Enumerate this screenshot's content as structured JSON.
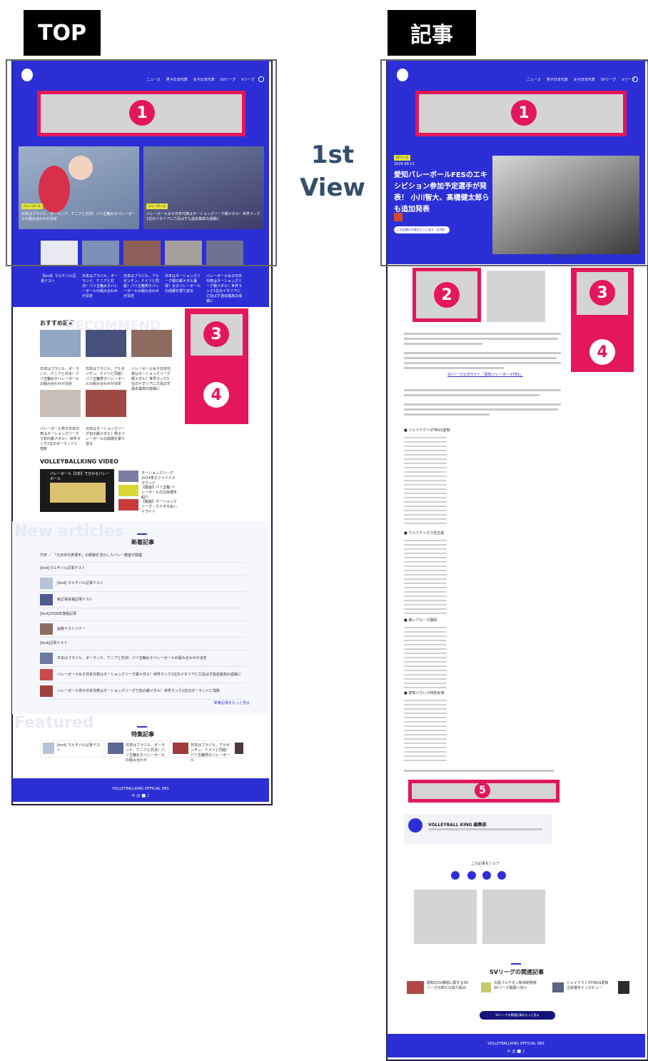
{
  "labels": {
    "top": "TOP",
    "article": "記事",
    "first_view": "1st View"
  },
  "badges": [
    "1",
    "2",
    "3",
    "4",
    "5"
  ],
  "site": {
    "nav": [
      "ニュース",
      "男子日本代表",
      "女子日本代表",
      "SVリーグ",
      "Vリーグ"
    ],
    "footer_title": "VOLLEYBALLKING OFFICIAL SNS"
  },
  "top": {
    "hero_cards": [
      {
        "tag": "バレーボール",
        "title": "日本はブラジル、ポーランド、ケニアと対決！パリ五輪女子バレーボールの組み合わせが決定"
      },
      {
        "tag": "バレーボール",
        "title": "バレーボール女子日本代表はネーションズリーグ銀メダル！世界ランク1位のイタリアに力及ばずも過去最高の成績に"
      }
    ],
    "thumbs": [
      {
        "title": "【bnd】マルチバル記事テスト"
      },
      {
        "title": "日本はブラジル、ポーランド、ケニアと対決！パリ五輪女子バレーボールの組み合わせが決定"
      },
      {
        "title": "日本はブラジル、アルゼンチン、ドイツと同組！パリ五輪男子バレーボールの組み合わせが決定"
      },
      {
        "title": "日本はネーションズリーグ銀の銀メダル獲得！女子バレーボールの成績を振り返る"
      },
      {
        "title": "バレーボール女子日本代表はネーションズリーグ銀メダル！世界ランク1位のイタリアに力及ばず過去最高の成績に"
      }
    ],
    "recommend_title": "おすすめ記事",
    "recommend_bg": "RECOMMEND",
    "recommend_cards": [
      {
        "title": "日本はブラジル、ポーランド、ケニアと対決！パリ五輪女子バレーボールの組み合わせが決定"
      },
      {
        "title": "日本はブラジル、アルゼンチン、ドイツと同組！パリ五輪男子バレーボールの組み合わせが決定"
      },
      {
        "title": "バレーボール女子日本代表はネーションズリーグ銀メダル！世界ランク1位のイタリアに力及ばず過去最高の成績に"
      },
      {
        "title": "バレーボール男子日本代表はネーションズリーグで初の銀メダル！ 世界ランク1位のポーランドに惜敗"
      },
      {
        "title": "日本はネーションズリーグ初の銀メダル！男子バレーボールの成績を振り返る"
      }
    ],
    "video_title": "VOLLEYBALLKING VIDEO",
    "video_caption": "バレーボール【1秒】で分かるバレーボール",
    "video_side": [
      {
        "title": "ネーションズリーグ2024男子ファイナルラウンド"
      },
      {
        "title": "【動画】パリ五輪 バレーボールの注目選手紹介"
      },
      {
        "title": "【動画】ネーションズリーグ・カナダ大会ハイライト"
      }
    ],
    "new_bg": "New articles",
    "new_title": "新着記事",
    "new_rows": [
      {
        "title": "TOP ／ 「元日本代表選手」の経験を活かしたバレー教室が開催",
        "thumb": false
      },
      {
        "title": "[bnd]マルチバル記事テスト",
        "thumb": false
      },
      {
        "title": "[bnd] マルチバル記事テスト",
        "thumb": true
      },
      {
        "title": "新記事投稿記事テスト",
        "thumb": true
      },
      {
        "title": "[bnd]2026年度版記事",
        "thumb": false
      },
      {
        "title": "画像テストバナー",
        "thumb": true
      },
      {
        "title": "[bnd]記事テスト",
        "thumb": false
      },
      {
        "title": "日本はブラジル、ポーランド、ケニアと対決！パリ五輪女子バレーボールの組み合わせが決定",
        "thumb": true
      },
      {
        "title": "バレーボール女子日本代表はネーションズリーグ銀メダル！世界ランク1位のイタリアに力及ばず過去最高の成績に",
        "thumb": true
      },
      {
        "title": "バレーボール男子日本代表はネーションズリーグで初の銀メダル！世界ランク1位のポーランドに惜敗",
        "thumb": true
      }
    ],
    "more_link": "新着記事をもっと見る",
    "featured_bg": "Featured",
    "featured_title": "特集記事",
    "featured_cards": [
      {
        "title": "[bnd] マルチバル記事テスト"
      },
      {
        "title": "日本はブラジル、ポーランド、ケニアと対決！パリ五輪女子バレーボールの組み合わせ"
      },
      {
        "title": "日本はブラジル、アルゼンチン、ドイツと同組！パリ五輪男子バレーボール"
      }
    ]
  },
  "article": {
    "category": "SVリーグ",
    "date": "2024.09.13",
    "headline": "愛知バレーボールFESのエキシビション参加予定選手が発表！ 小川智大、髙橋健太郎らも追加発表",
    "cta": "この記事の写真をもっと見る（全7枚）",
    "photo_caption": "（写真）SVリーグ",
    "link_text": "SVリーグ公式サイト「愛知バレーボールFES」",
    "lists": [
      "■ ジェイテクトSTINGS愛知",
      "■ ウルフドッグス名古屋",
      "■ 東レアローズ静岡",
      "■ 愛知パラレル特別出演"
    ],
    "profile_name": "VOLLEYBALL KING 編集部",
    "share_title": "この記事をシェア",
    "related_title": "SVリーグの関連記事",
    "related_cards": [
      {
        "title": "愛知のSV構想に関するSVリーグの新たな取り組み"
      },
      {
        "title": "大阪ブルテオン新体制発表 SVリーグ開幕へ向け"
      },
      {
        "title": "ジェイテクトSTINGS愛知 注目選手インタビュー"
      }
    ],
    "related_button": "SVリーグの関連記事をもっと見る"
  }
}
